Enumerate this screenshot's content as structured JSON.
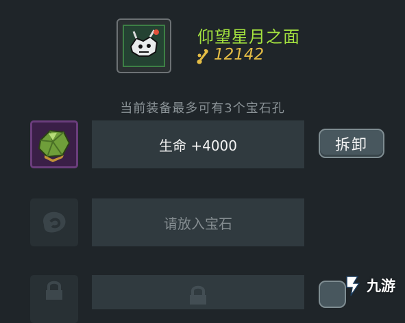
{
  "item": {
    "name": "仰望星月之面",
    "price": "12142",
    "icon": "mask-helmet-icon",
    "price_icon": "gold-bone-icon"
  },
  "sockets": {
    "info": "当前装备最多可有3个宝石孔",
    "slots": [
      {
        "state": "filled",
        "gem_icon": "green-gem-icon",
        "label": "生命 +4000",
        "action": "拆卸"
      },
      {
        "state": "empty",
        "gem_icon": "empty-gem-placeholder-icon",
        "label": "请放入宝石"
      },
      {
        "state": "locked",
        "gem_icon": "lock-icon",
        "label": ""
      }
    ]
  },
  "watermark": {
    "text": "九游",
    "icon": "nine-game-logo-icon"
  },
  "colors": {
    "background": "#1f2529",
    "title_green": "#a4e33f",
    "price_gold": "#e4bd45",
    "slot_bar": "#303a3f",
    "button": "#48575e"
  }
}
